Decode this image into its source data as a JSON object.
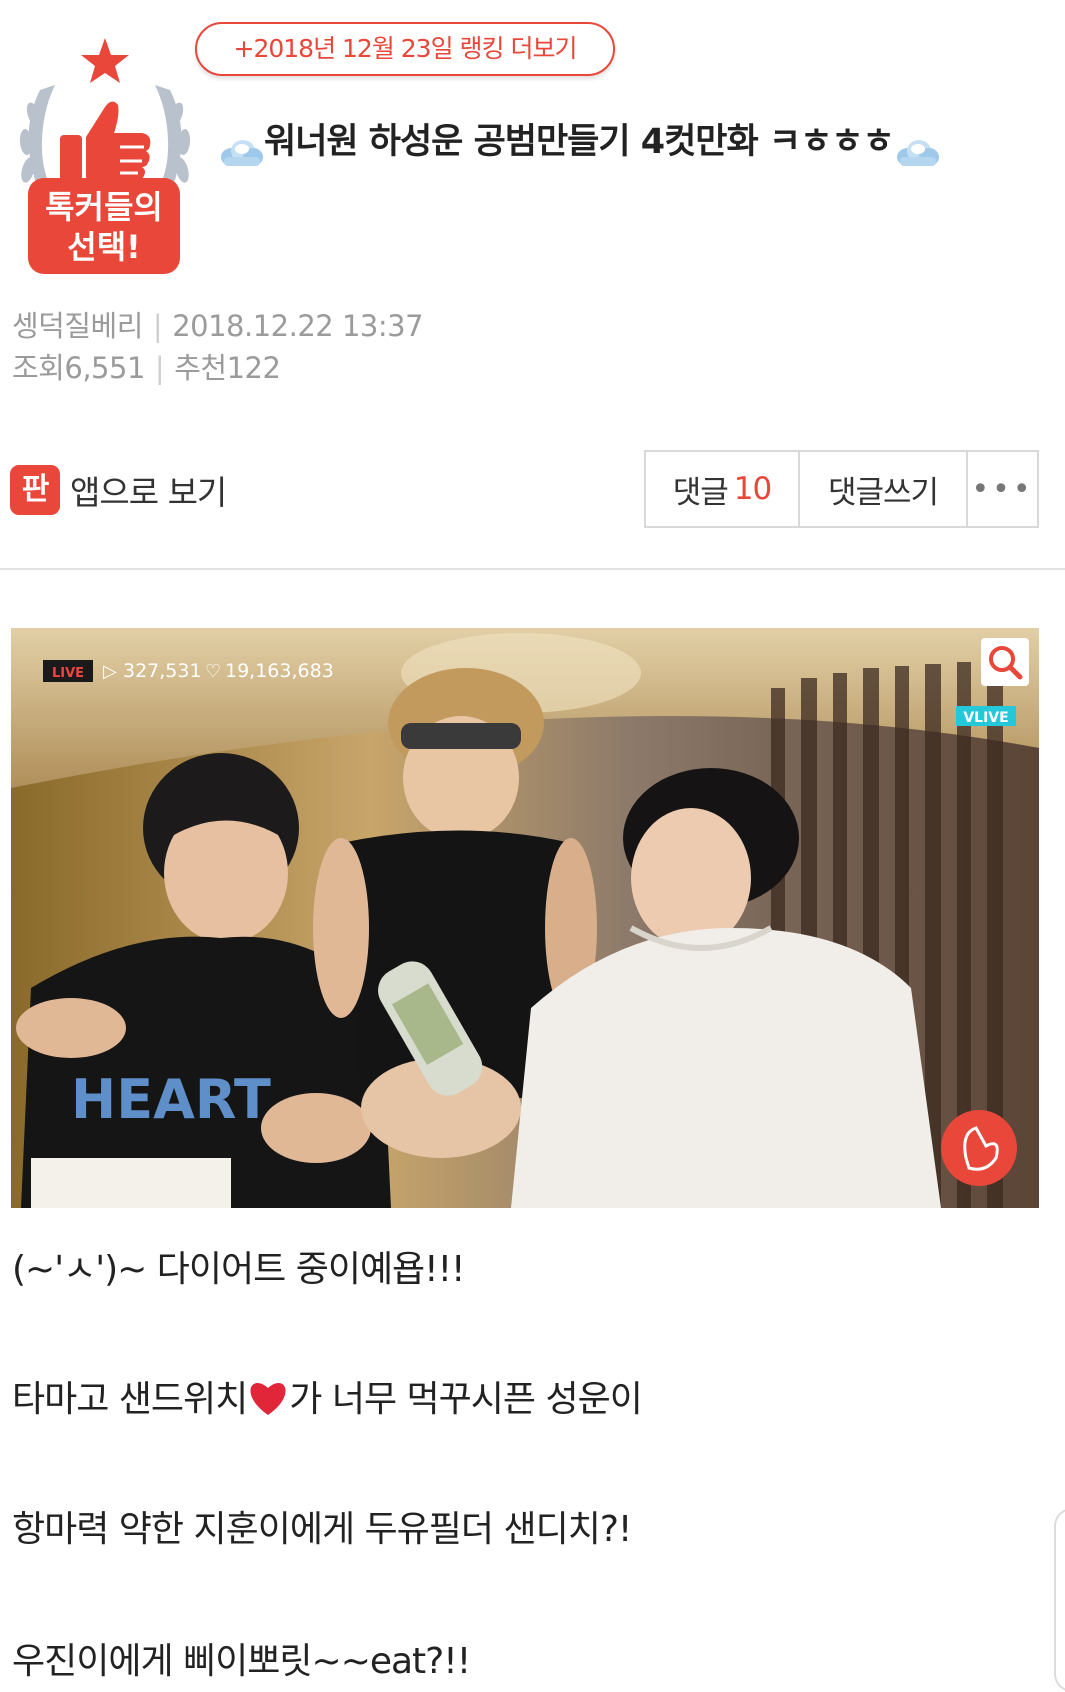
{
  "badge": {
    "line1": "톡커들의",
    "line2": "선택!"
  },
  "ranking_link": "+2018년 12월 23일 랭킹 더보기",
  "post": {
    "title": "워너원 하성운 공범만들기 4컷만화 ㅋㅎㅎㅎ",
    "author": "셍덕질베리",
    "datetime": "2018.12.22 13:37",
    "views_label": "조회",
    "views": "6,551",
    "recommend_label": "추천",
    "recommends": "122"
  },
  "app_view": {
    "icon_text": "판",
    "label": "앱으로 보기"
  },
  "actions": {
    "comments_label": "댓글",
    "comments_count": "10",
    "write_comment": "댓글쓰기",
    "more": "•••"
  },
  "image": {
    "live_label": "LIVE",
    "play_count": "327,531",
    "like_count": "19,163,683",
    "vlive_label": "VLIVE",
    "tshirt_text": "HEART"
  },
  "body": {
    "line1": "(~'ㅅ')~ 다이어트 중이예욥!!!",
    "line2a": "타마고 샌드위치",
    "line2b": "가 너무 먹꾸시픈 성운이",
    "line3": "항마력 약한 지훈이에게 두유필더 샌디치?!",
    "line4": "우진이에게 삐이뽀릿~~eat?!!"
  },
  "colors": {
    "accent": "#e8473a",
    "meta": "#9b9b9b",
    "border": "#d9d9d9"
  }
}
